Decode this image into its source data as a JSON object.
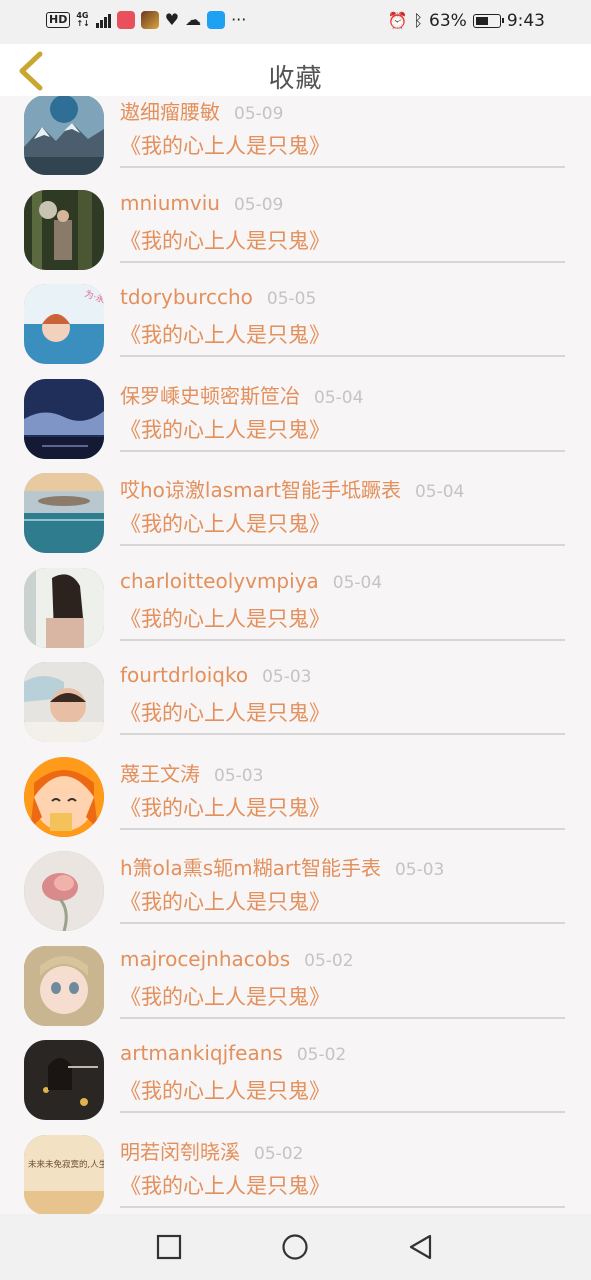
{
  "status_bar": {
    "hd": "HD",
    "network": "4G",
    "battery": "63%",
    "time": "9:43",
    "battery_level_pct": 63,
    "left_icons": [
      "signal-icon",
      "notes-app-icon",
      "game-app-icon",
      "health-icon",
      "weather-icon",
      "bulb-app-icon",
      "more-dots-icon"
    ],
    "right_icons": [
      "alarm-icon",
      "bluetooth-icon"
    ]
  },
  "header": {
    "title": "收藏"
  },
  "list": {
    "items": [
      {
        "name": "遨细瘤腰敏",
        "date": "05-09",
        "book": "《我的心上人是只鬼》",
        "avatar": "mountain-lake"
      },
      {
        "name": "mniumviu",
        "date": "05-09",
        "book": "《我的心上人是只鬼》",
        "avatar": "forest-girl"
      },
      {
        "name": "tdoryburccho",
        "date": "05-05",
        "book": "《我的心上人是只鬼》",
        "avatar": "anime-text"
      },
      {
        "name": "保罗嵊史顿密斯笸冶",
        "date": "05-04",
        "book": "《我的心上人是只鬼》",
        "avatar": "night-sky"
      },
      {
        "name": "哎ho谅激lasmart智能手坻蹶表",
        "date": "05-04",
        "book": "《我的心上人是只鬼》",
        "avatar": "sunset-sea"
      },
      {
        "name": "charloitteolyvmpiya",
        "date": "05-04",
        "book": "《我的心上人是只鬼》",
        "avatar": "long-hair"
      },
      {
        "name": "fourtdrloiqko",
        "date": "05-03",
        "book": "《我的心上人是只鬼》",
        "avatar": "sleeping-baby"
      },
      {
        "name": "蔑王文涛",
        "date": "05-03",
        "book": "《我的心上人是只鬼》",
        "avatar": "anime-orange"
      },
      {
        "name": "h箫ola熏s轭m糊art智能手表",
        "date": "05-03",
        "book": "《我的心上人是只鬼》",
        "avatar": "pink-flower"
      },
      {
        "name": "majrocejnhacobs",
        "date": "05-02",
        "book": "《我的心上人是只鬼》",
        "avatar": "doll-face"
      },
      {
        "name": "artmankiqjfeans",
        "date": "05-02",
        "book": "《我的心上人是只鬼》",
        "avatar": "dark-portrait"
      },
      {
        "name": "明若闵刳晓溪",
        "date": "05-02",
        "book": "《我的心上人是只鬼》",
        "avatar": "calligraphy-text"
      }
    ]
  },
  "avatar_texts": {
    "anime-text": "为·永恒守护",
    "calligraphy-text": "未来未免寂寞的,人生会把你磨掉。"
  },
  "colors": {
    "accent": "#e3905c",
    "date": "#c4c4c4",
    "separator": "#d6d6d6",
    "back_arrow": "#c8a832",
    "background": "#f7f5f5"
  },
  "nav_bar": {
    "buttons": [
      "recent-apps-icon",
      "home-icon",
      "back-triangle-icon"
    ]
  }
}
